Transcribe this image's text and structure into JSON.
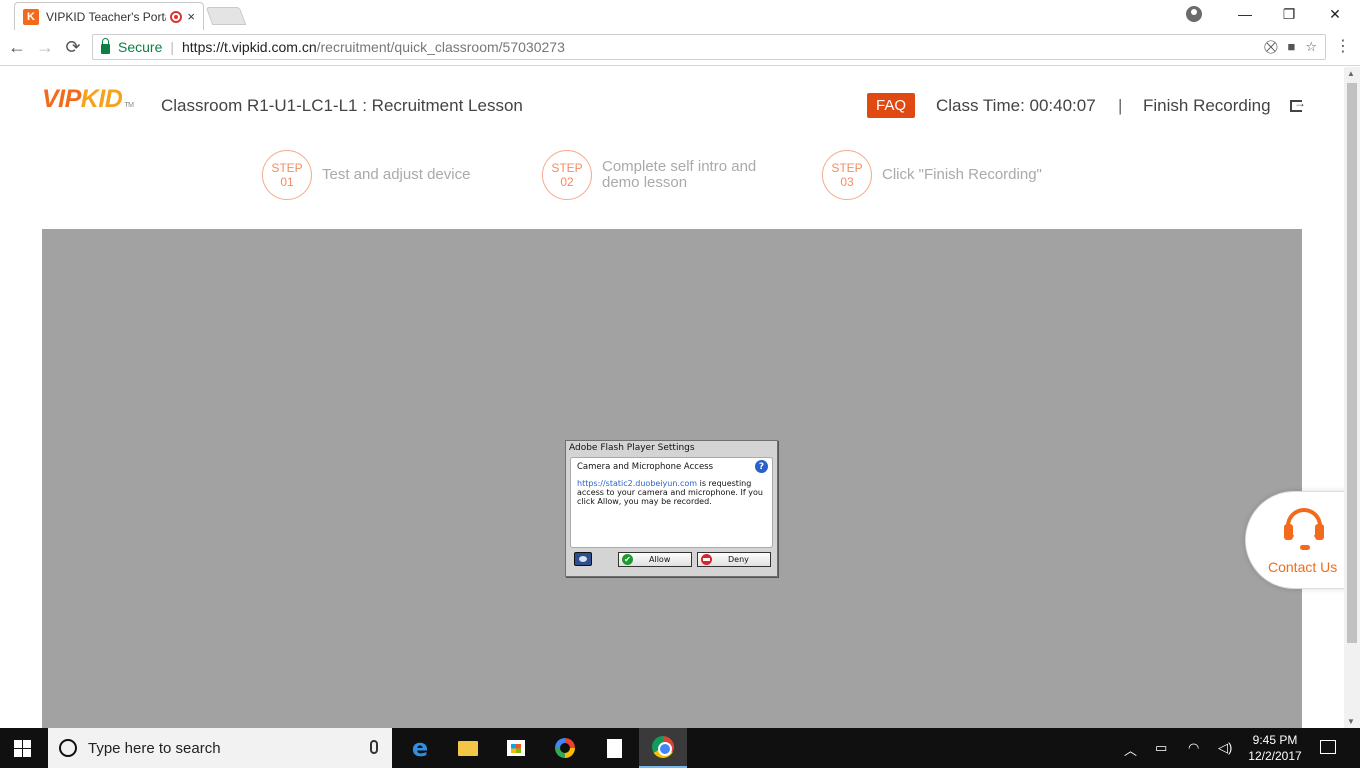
{
  "browser": {
    "tab_title": "VIPKID Teacher's Portal",
    "tab_favicon": "K",
    "tab_close": "×",
    "security_label": "Secure",
    "url_host": "https://t.vipkid.com.cn",
    "url_path": "/recruitment/quick_classroom/57030273",
    "window_controls": {
      "minimize": "—",
      "restore": "❐",
      "close": "✕"
    },
    "nav": {
      "back": "←",
      "forward": "→",
      "reload": "⟳"
    }
  },
  "header": {
    "logo_vip": "VIP",
    "logo_kid": "KID",
    "logo_tm": "TM",
    "classroom_title": "Classroom R1-U1-LC1-L1 : Recruitment Lesson",
    "faq_label": "FAQ",
    "class_time": "Class Time: 00:40:07",
    "separator": "|",
    "finish_label": "Finish Recording"
  },
  "steps": [
    {
      "word": "STEP",
      "num": "01",
      "text": "Test and adjust device"
    },
    {
      "word": "STEP",
      "num": "02",
      "text": "Complete self intro and demo lesson"
    },
    {
      "word": "STEP",
      "num": "03",
      "text": "Click \"Finish Recording\""
    }
  ],
  "flash_dialog": {
    "title": "Adobe Flash Player Settings",
    "heading": "Camera and Microphone Access",
    "help": "?",
    "link": "https://static2.duobeiyun.com",
    "message": "is requesting access to your camera and microphone. If you click Allow, you may be recorded.",
    "allow_label": "Allow",
    "deny_label": "Deny"
  },
  "contact": {
    "label": "Contact Us"
  },
  "taskbar": {
    "search_placeholder": "Type here to search",
    "time": "9:45 PM",
    "date": "12/2/2017"
  },
  "colors": {
    "brand_orange": "#f26b1d",
    "faq_bg": "#e04a12",
    "secure_green": "#0b8043",
    "stage_gray": "#a2a2a2"
  }
}
